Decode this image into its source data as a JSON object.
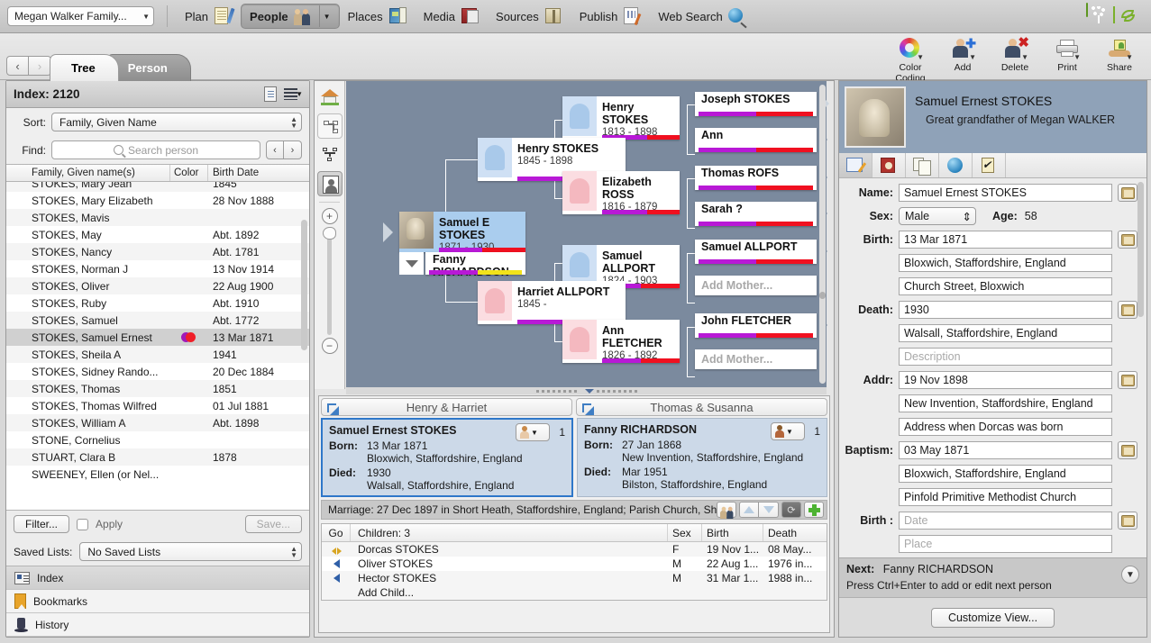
{
  "menubar": {
    "project": "Megan Walker Family...",
    "items": [
      {
        "label": "Plan",
        "icon": "note-pen-icon",
        "selected": false
      },
      {
        "label": "People",
        "icon": "people-icon",
        "selected": true
      },
      {
        "label": "Places",
        "icon": "map-icon",
        "selected": false
      },
      {
        "label": "Media",
        "icon": "media-icon",
        "selected": false
      },
      {
        "label": "Sources",
        "icon": "book-icon",
        "selected": false
      },
      {
        "label": "Publish",
        "icon": "publish-icon",
        "selected": false
      },
      {
        "label": "Web Search",
        "icon": "web-search-icon",
        "selected": false
      }
    ]
  },
  "toolbar": {
    "buttons": [
      {
        "label": "Color Coding",
        "icon": "color-wheel-icon"
      },
      {
        "label": "Add",
        "icon": "add-person-icon"
      },
      {
        "label": "Delete",
        "icon": "delete-person-icon"
      },
      {
        "label": "Print",
        "icon": "printer-icon"
      },
      {
        "label": "Share",
        "icon": "share-icon"
      }
    ]
  },
  "tabs": [
    {
      "label": "Tree",
      "active": true
    },
    {
      "label": "Person",
      "active": false
    }
  ],
  "sidebar": {
    "title": "Index: 2120",
    "sort_label": "Sort:",
    "sort_value": "Family, Given Name",
    "find_label": "Find:",
    "find_placeholder": "Search person",
    "columns": [
      "Family, Given name(s)",
      "Color",
      "Birth Date"
    ],
    "rows": [
      {
        "name": "STOKES, Mary Jean",
        "birth": "1845",
        "color": false,
        "selected": false,
        "clipped": true
      },
      {
        "name": "STOKES, Mary Elizabeth",
        "birth": "28 Nov 1888",
        "color": false,
        "selected": false
      },
      {
        "name": "STOKES, Mavis",
        "birth": "",
        "color": false,
        "selected": false
      },
      {
        "name": "STOKES, May",
        "birth": "Abt. 1892",
        "color": false,
        "selected": false
      },
      {
        "name": "STOKES, Nancy",
        "birth": "Abt. 1781",
        "color": false,
        "selected": false
      },
      {
        "name": "STOKES, Norman J",
        "birth": "13 Nov 1914",
        "color": false,
        "selected": false
      },
      {
        "name": "STOKES, Oliver",
        "birth": "22 Aug 1900",
        "color": false,
        "selected": false
      },
      {
        "name": "STOKES, Ruby",
        "birth": "Abt. 1910",
        "color": false,
        "selected": false
      },
      {
        "name": "STOKES, Samuel",
        "birth": "Abt. 1772",
        "color": false,
        "selected": false
      },
      {
        "name": "STOKES, Samuel Ernest",
        "birth": "13 Mar 1871",
        "color": true,
        "selected": true
      },
      {
        "name": "STOKES, Sheila A",
        "birth": "1941",
        "color": false,
        "selected": false
      },
      {
        "name": "STOKES, Sidney Rando...",
        "birth": "20 Dec 1884",
        "color": false,
        "selected": false
      },
      {
        "name": "STOKES, Thomas",
        "birth": "1851",
        "color": false,
        "selected": false
      },
      {
        "name": "STOKES, Thomas Wilfred",
        "birth": "01 Jul 1881",
        "color": false,
        "selected": false
      },
      {
        "name": "STOKES, William A",
        "birth": "Abt. 1898",
        "color": false,
        "selected": false
      },
      {
        "name": "STONE, Cornelius",
        "birth": "",
        "color": false,
        "selected": false
      },
      {
        "name": "STUART, Clara B",
        "birth": "1878",
        "color": false,
        "selected": false
      },
      {
        "name": "SWEENEY, Ellen (or Nel...",
        "birth": "",
        "color": false,
        "selected": false
      }
    ],
    "filter_button": "Filter...",
    "apply_label": "Apply",
    "save_button": "Save...",
    "saved_lists_label": "Saved Lists:",
    "saved_lists_value": "No Saved Lists",
    "nav_tabs": [
      {
        "label": "Index",
        "icon": "index-icon",
        "active": true
      },
      {
        "label": "Bookmarks",
        "icon": "bookmark-icon",
        "active": false
      },
      {
        "label": "History",
        "icon": "top-hat-icon",
        "active": false
      }
    ]
  },
  "tree": {
    "cards": [
      {
        "id": "henry1813",
        "name": "Henry STOKES",
        "dates": "1813 - 1898",
        "sex": "m",
        "photo": false,
        "bars": [
          {
            "color": "#b819d6",
            "pct": 58
          },
          {
            "color": "#f01020",
            "pct": 42
          }
        ]
      },
      {
        "id": "henry1845",
        "name": "Henry STOKES",
        "dates": "1845 - 1898",
        "sex": "m",
        "photo": false,
        "bars": [
          {
            "color": "#b819d6",
            "pct": 50
          },
          {
            "color": "#f01020",
            "pct": 50
          }
        ]
      },
      {
        "id": "elizabeth",
        "name": "Elizabeth ROSS",
        "dates": "1816 - 1879",
        "sex": "f",
        "photo": false,
        "bars": [
          {
            "color": "#b819d6",
            "pct": 58
          },
          {
            "color": "#f01020",
            "pct": 42
          }
        ]
      },
      {
        "id": "samuel",
        "name": "Samuel E STOKES",
        "dates": "1871 - 1930",
        "sex": "m",
        "photo": true,
        "bars": [
          {
            "color": "#b819d6",
            "pct": 50
          },
          {
            "color": "#f01020",
            "pct": 50
          }
        ]
      },
      {
        "id": "fanny",
        "name": "Fanny RICHARDSON",
        "dates": "",
        "sex": "f",
        "photo": false,
        "bars": [
          {
            "color": "#b819d6",
            "pct": 52
          },
          {
            "color": "#f2e21a",
            "pct": 48
          }
        ]
      },
      {
        "id": "samallport",
        "name": "Samuel ALLPORT",
        "dates": "1824 - 1903",
        "sex": "m",
        "photo": false,
        "bars": [
          {
            "color": "#b819d6",
            "pct": 50
          },
          {
            "color": "#f01020",
            "pct": 50
          }
        ]
      },
      {
        "id": "harriet",
        "name": "Harriet ALLPORT",
        "dates": "1845 -",
        "sex": "f",
        "photo": false,
        "bars": [
          {
            "color": "#b819d6",
            "pct": 50
          },
          {
            "color": "#f01020",
            "pct": 50
          }
        ]
      },
      {
        "id": "annfletcher",
        "name": "Ann FLETCHER",
        "dates": "1826 - 1892",
        "sex": "f",
        "photo": false,
        "bars": [
          {
            "color": "#b819d6",
            "pct": 50
          },
          {
            "color": "#f01020",
            "pct": 50
          }
        ]
      }
    ],
    "ancestors": [
      {
        "name": "Joseph STOKES",
        "empty": false,
        "arrow": "solid"
      },
      {
        "name": "Ann",
        "empty": false,
        "arrow": "hollow"
      },
      {
        "name": "Thomas ROFS",
        "empty": false,
        "arrow": "hollow"
      },
      {
        "name": "Sarah ?",
        "empty": false,
        "arrow": "hollow"
      },
      {
        "name": "Samuel ALLPORT",
        "empty": false,
        "arrow": "hollow"
      },
      {
        "name": "Add Mother...",
        "empty": true,
        "arrow": "none"
      },
      {
        "name": "John FLETCHER",
        "empty": false,
        "arrow": "hollow"
      },
      {
        "name": "Add Mother...",
        "empty": true,
        "arrow": "none"
      }
    ],
    "sidetools": [
      "home-icon",
      "org-chart-icon",
      "fan-chart-icon",
      "portrait-icon",
      "zoom-in-icon",
      "zoom-out-icon"
    ]
  },
  "family": {
    "panels": [
      {
        "header": "Henry & Harriet"
      },
      {
        "header": "Thomas  & Susanna"
      }
    ],
    "people": [
      {
        "name": "Samuel Ernest STOKES",
        "born_label": "Born:",
        "born_date": "13 Mar 1871",
        "born_place": "Bloxwich, Staffordshire, England",
        "died_label": "Died:",
        "died_date": "1930",
        "died_place": "Walsall, Staffordshire, England",
        "sex": "f-icon",
        "count": "1",
        "selected": true
      },
      {
        "name": "Fanny RICHARDSON",
        "born_label": "Born:",
        "born_date": "27 Jan 1868",
        "born_place": "New Invention, Staffordshire, England",
        "died_label": "Died:",
        "died_date": "Mar 1951",
        "died_place": "Bilston, Staffordshire, England",
        "sex": "m-icon",
        "count": "1",
        "selected": false
      }
    ],
    "marriage": "Marriage: 27 Dec 1897 in Short Heath, Staffordshire, England; Parish Church, Sh",
    "children_columns": [
      "Go",
      "Children: 3",
      "Sex",
      "Birth",
      "Death"
    ],
    "children": [
      {
        "go": "gold",
        "name": "Dorcas STOKES",
        "sex": "F",
        "birth": "19 Nov 1...",
        "death": "08 May..."
      },
      {
        "go": "blue",
        "name": "Oliver STOKES",
        "sex": "M",
        "birth": "22 Aug 1...",
        "death": "1976 in..."
      },
      {
        "go": "blue",
        "name": "Hector STOKES",
        "sex": "M",
        "birth": "31 Mar 1...",
        "death": "1988 in..."
      }
    ],
    "add_child": "Add Child..."
  },
  "detail": {
    "name_heading": "Samuel Ernest STOKES",
    "relationship": "Great grandfather of Megan WALKER",
    "tabs": [
      "edit-tab",
      "sources-tab",
      "notes-tab",
      "web-tab",
      "tasks-tab"
    ],
    "fields": [
      {
        "label": "Name:",
        "value": "Samuel Ernest STOKES",
        "type": "text",
        "button": true
      },
      {
        "label": "Sex:",
        "value": "Male",
        "type": "select",
        "age_label": "Age:",
        "age_value": "58"
      },
      {
        "label": "Birth:",
        "value": "13 Mar 1871",
        "type": "text",
        "button": true
      },
      {
        "label": "",
        "value": "Bloxwich, Staffordshire, England",
        "type": "text",
        "button": false
      },
      {
        "label": "",
        "value": "Church Street, Bloxwich",
        "type": "text",
        "button": false
      },
      {
        "label": "Death:",
        "value": "1930",
        "type": "text",
        "button": true
      },
      {
        "label": "",
        "value": "Walsall, Staffordshire, England",
        "type": "text",
        "button": false
      },
      {
        "label": "",
        "value": "Description",
        "type": "placeholder",
        "button": false
      },
      {
        "label": "Addr:",
        "value": "19 Nov 1898",
        "type": "text",
        "button": true
      },
      {
        "label": "",
        "value": "New Invention, Staffordshire, England",
        "type": "text",
        "button": false
      },
      {
        "label": "",
        "value": "Address when Dorcas was born",
        "type": "text",
        "button": false
      },
      {
        "label": "Baptism:",
        "value": "03 May 1871",
        "type": "text",
        "button": true
      },
      {
        "label": "",
        "value": "Bloxwich, Staffordshire, England",
        "type": "text",
        "button": false
      },
      {
        "label": "",
        "value": "Pinfold Primitive Methodist Church",
        "type": "text",
        "button": false
      },
      {
        "label": "Birth :",
        "value": "Date",
        "type": "placeholder",
        "button": true
      },
      {
        "label": "",
        "value": "Place",
        "type": "placeholder",
        "button": false
      }
    ],
    "next_label": "Next:",
    "next_person": "Fanny RICHARDSON",
    "next_hint": "Press Ctrl+Enter to add or edit next person",
    "customize_button": "Customize View..."
  },
  "colors": {
    "canvas_bg": "#7b8a9e",
    "accent_blue": "#2e77c9",
    "bar_purple": "#b819d6",
    "bar_red": "#f01020",
    "bar_yellow": "#f2e21a",
    "header_blue": "#8fa2b8"
  }
}
